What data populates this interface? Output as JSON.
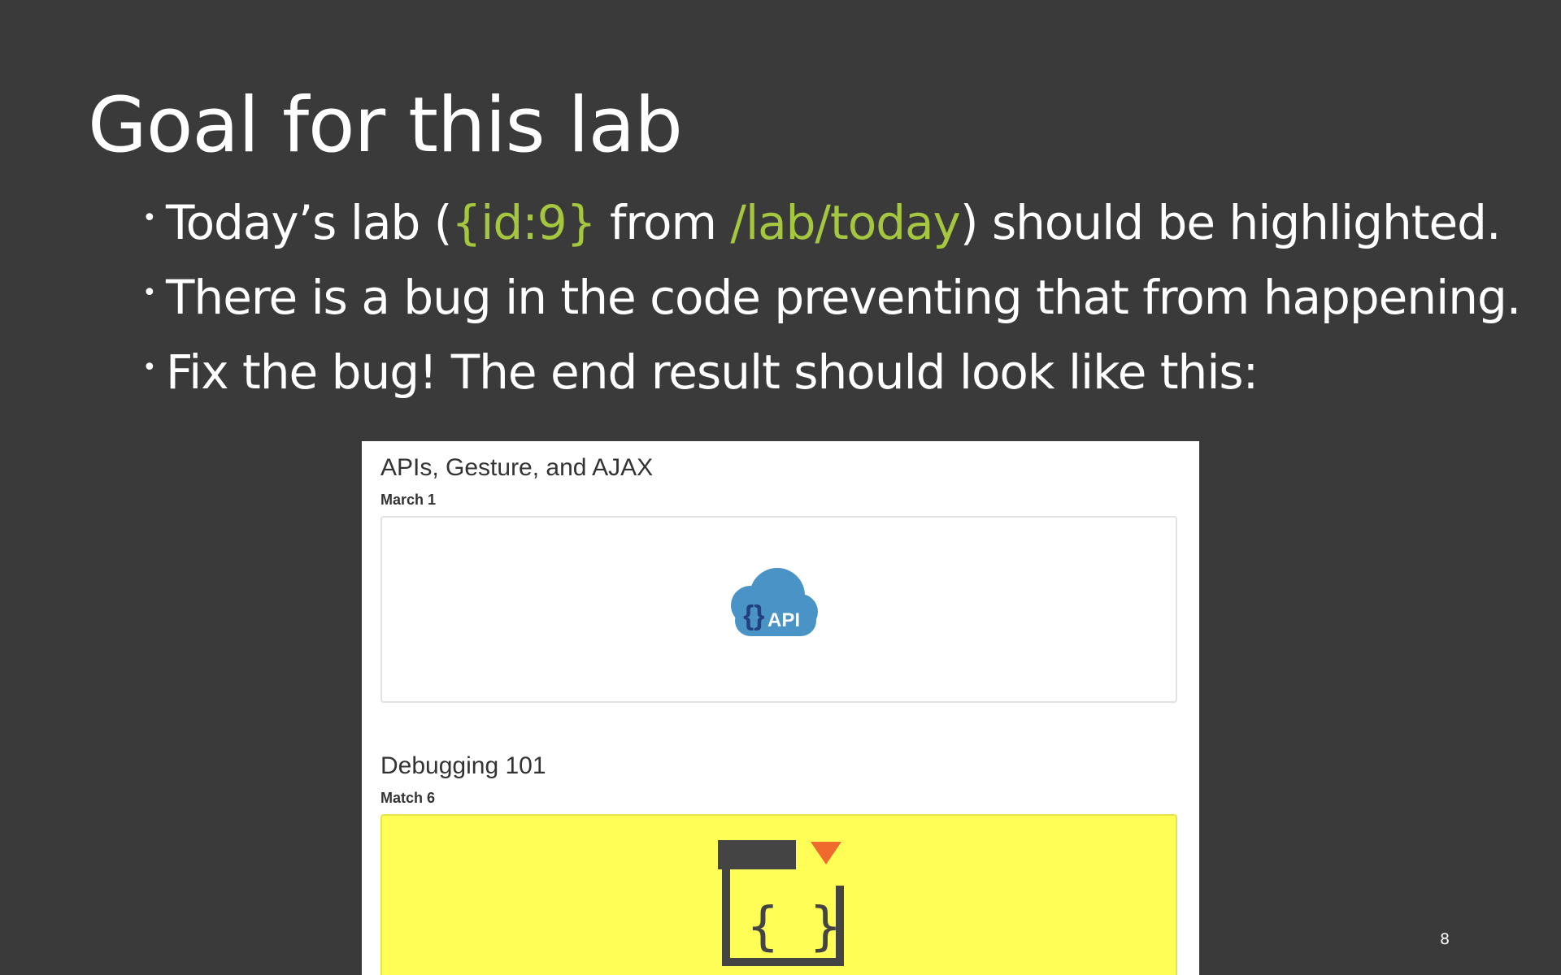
{
  "slide": {
    "title": "Goal for this lab",
    "bullets": [
      {
        "parts": [
          {
            "text": "Today’s lab (",
            "highlight": false
          },
          {
            "text": "{id:9}",
            "highlight": true
          },
          {
            "text": " from ",
            "highlight": false
          },
          {
            "text": "/lab/today",
            "highlight": true
          },
          {
            "text": ") should be highlighted.",
            "highlight": false
          }
        ]
      },
      {
        "parts": [
          {
            "text": "There is a bug in the code preventing that from happening.",
            "highlight": false
          }
        ]
      },
      {
        "parts": [
          {
            "text": "Fix the bug! The end result should look like this:",
            "highlight": false
          }
        ]
      }
    ],
    "page_number": "8",
    "colors": {
      "background": "#3a3a3a",
      "text": "#ffffff",
      "highlight": "#a4c73f"
    }
  },
  "screenshot": {
    "cards": [
      {
        "title": "APIs, Gesture, and AJAX",
        "date": "March 1",
        "icon": "api-cloud-icon",
        "icon_text": "API",
        "highlighted": false
      },
      {
        "title": "Debugging 101",
        "date": "Match 6",
        "icon": "debug-window-icon",
        "icon_text": "{ }",
        "highlighted": true,
        "highlight_color": "#fffe57"
      }
    ]
  }
}
